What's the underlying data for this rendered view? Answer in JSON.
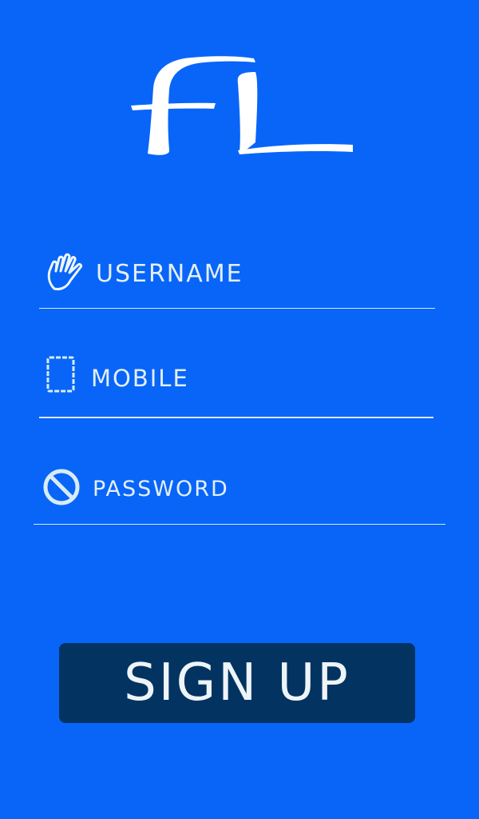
{
  "logo": {
    "text": "fL",
    "icon": "fl-logo"
  },
  "fields": {
    "username": {
      "placeholder": "USERNAME",
      "icon": "hand-icon"
    },
    "mobile": {
      "placeholder": "MOBILE",
      "icon": "phone-icon"
    },
    "password": {
      "placeholder": "PASSWORD",
      "icon": "prohibited-icon"
    }
  },
  "signup": {
    "label": "SIGN UP"
  },
  "colors": {
    "background": "#0865f8",
    "button": "#033361",
    "text": "#e3eff5"
  }
}
